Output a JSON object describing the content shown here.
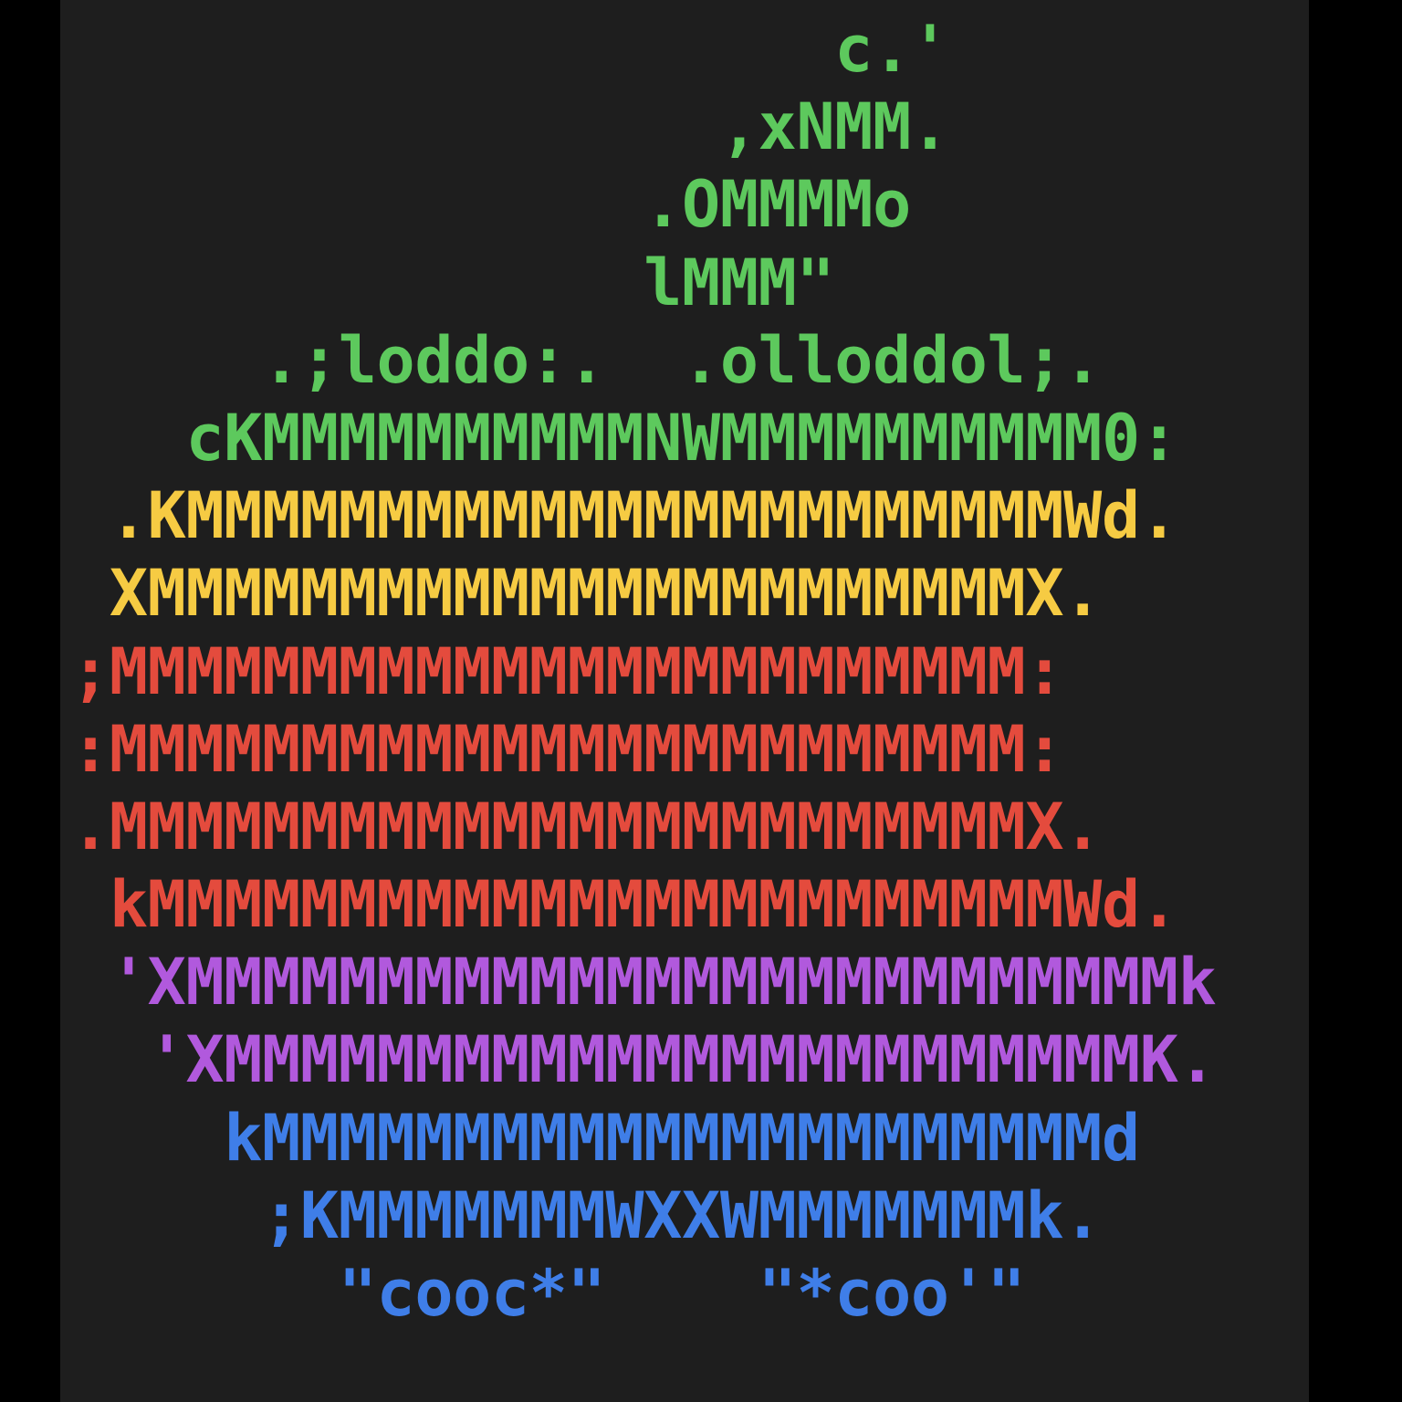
{
  "colors": {
    "background": "#1e1e1e",
    "outer": "#000000",
    "green": "#5dc95d",
    "yellow": "#f6cb43",
    "red": "#e44b3d",
    "purple": "#b159dd",
    "blue": "#3f7ee8"
  },
  "ascii_logo": {
    "lines": [
      {
        "text": "                    c.'",
        "color": "green"
      },
      {
        "text": "                 ,xNMM.",
        "color": "green"
      },
      {
        "text": "               .OMMMMo",
        "color": "green"
      },
      {
        "text": "               lMMM\"",
        "color": "green"
      },
      {
        "text": "     .;loddo:.  .olloddol;.",
        "color": "green"
      },
      {
        "text": "   cKMMMMMMMMMMNWMMMMMMMMMM0:",
        "color": "green"
      },
      {
        "text": " .KMMMMMMMMMMMMMMMMMMMMMMMWd.",
        "color": "yellow"
      },
      {
        "text": " XMMMMMMMMMMMMMMMMMMMMMMMX.",
        "color": "yellow"
      },
      {
        "text": ";MMMMMMMMMMMMMMMMMMMMMMMM:",
        "color": "red"
      },
      {
        "text": ":MMMMMMMMMMMMMMMMMMMMMMMM:",
        "color": "red"
      },
      {
        "text": ".MMMMMMMMMMMMMMMMMMMMMMMMX.",
        "color": "red"
      },
      {
        "text": " kMMMMMMMMMMMMMMMMMMMMMMMMWd.",
        "color": "red"
      },
      {
        "text": " 'XMMMMMMMMMMMMMMMMMMMMMMMMMMk",
        "color": "purple"
      },
      {
        "text": "  'XMMMMMMMMMMMMMMMMMMMMMMMMK.",
        "color": "purple"
      },
      {
        "text": "    kMMMMMMMMMMMMMMMMMMMMMMd",
        "color": "blue"
      },
      {
        "text": "     ;KMMMMMMMWXXWMMMMMMMk.",
        "color": "blue"
      },
      {
        "text": "       \"cooc*\"    \"*coo'\"",
        "color": "blue"
      }
    ]
  }
}
